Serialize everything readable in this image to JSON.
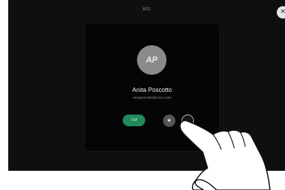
{
  "status": {
    "title": "802"
  },
  "corner_button": {
    "icon": "close-icon",
    "glyph": "✕"
  },
  "contact": {
    "avatar_initials": "AP",
    "name": "Anita Poscotto",
    "address": "ranaposcotto@cisco.com"
  },
  "actions": {
    "call_label": "Call",
    "favorite_icon": "star-icon",
    "favorite_glyph": "★",
    "more_icon": "more-icon",
    "more_glyph": "…"
  },
  "colors": {
    "screen_bg": "#0f0f0f",
    "card_bg": "#050505",
    "call_green": "#1f8a5a",
    "avatar_gray": "#8a8a8a"
  }
}
